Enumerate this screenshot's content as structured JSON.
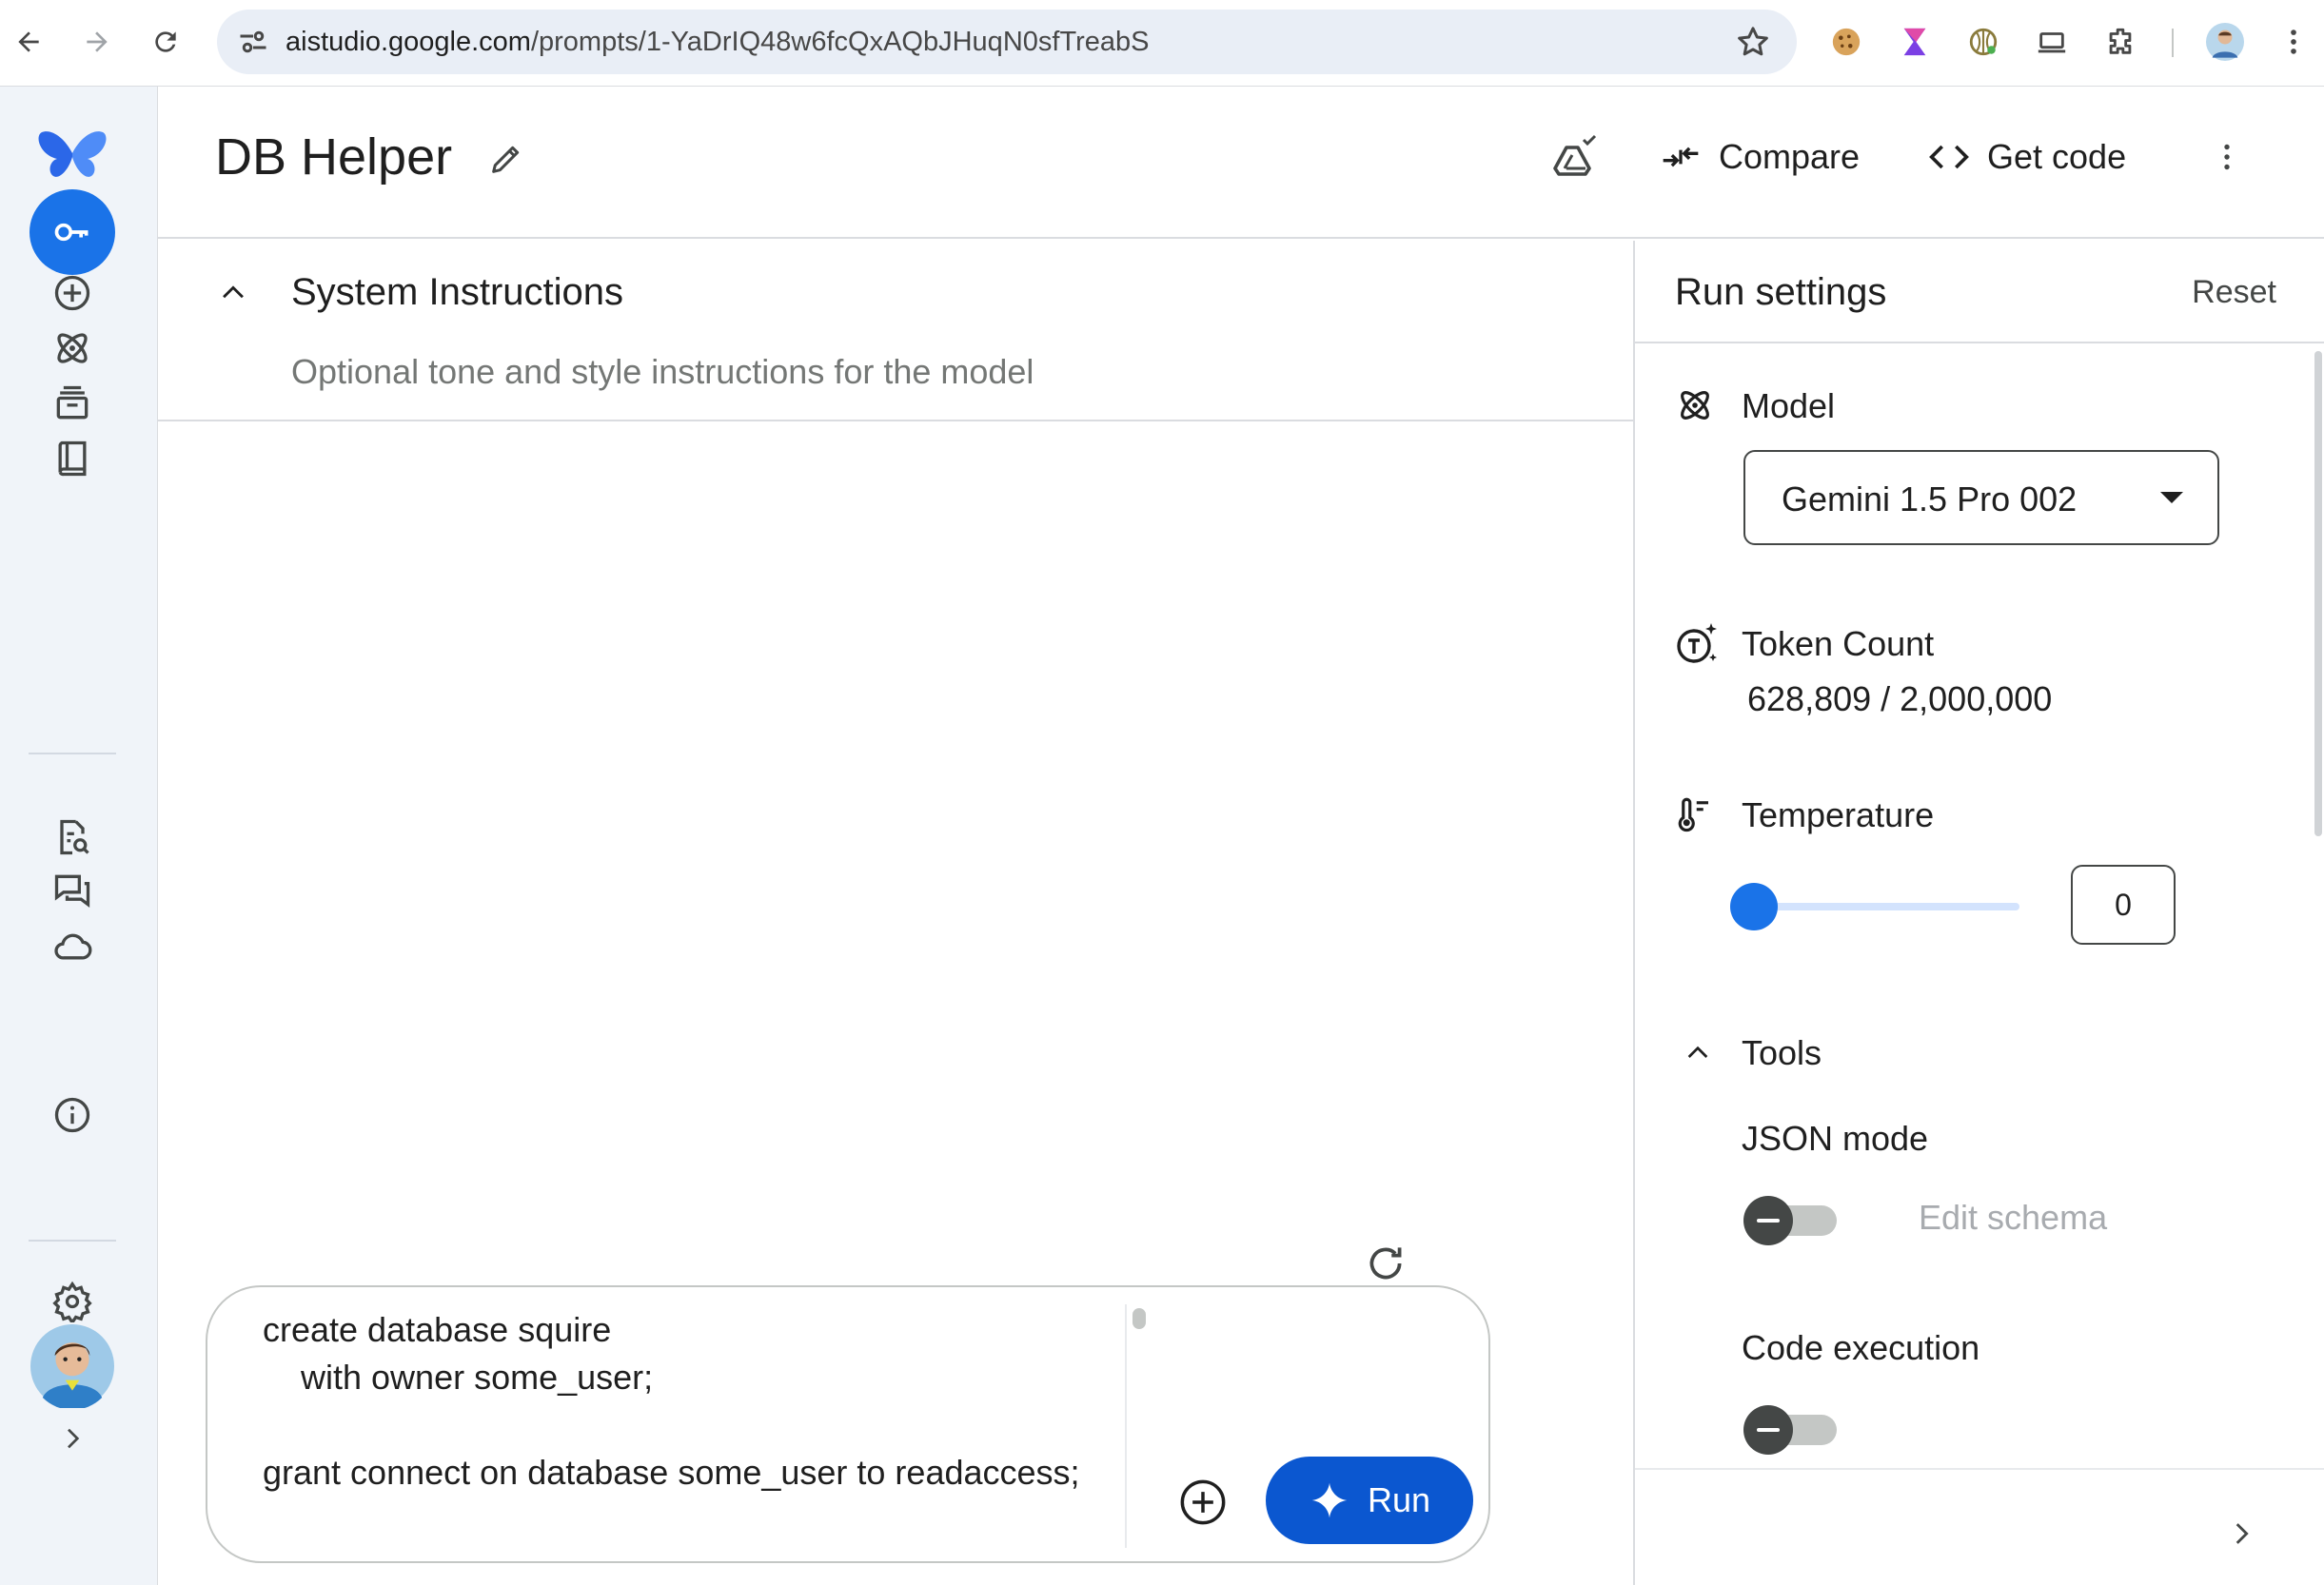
{
  "browser": {
    "url_host": "aistudio.google.com",
    "url_path": "/prompts/1-YaDrIQ48w6fcQxAQbJHuqN0sfTreabS"
  },
  "header": {
    "title": "DB Helper",
    "compare_label": "Compare",
    "get_code_label": "Get code"
  },
  "system_instructions": {
    "title": "System Instructions",
    "placeholder": "Optional tone and style instructions for the model"
  },
  "prompt": {
    "text": "create database squire\n    with owner some_user;\n\ngrant connect on database some_user to readaccess;",
    "run_label": "Run"
  },
  "run_settings": {
    "title": "Run settings",
    "reset_label": "Reset",
    "model": {
      "label": "Model",
      "value": "Gemini 1.5 Pro 002"
    },
    "token_count": {
      "label": "Token Count",
      "value": "628,809 / 2,000,000",
      "used": 628809,
      "max": 2000000
    },
    "temperature": {
      "label": "Temperature",
      "value": "0",
      "slider_fraction": 0
    },
    "tools": {
      "label": "Tools",
      "json_mode": {
        "label": "JSON mode",
        "enabled": false,
        "edit_schema_label": "Edit schema"
      },
      "code_execution": {
        "label": "Code execution",
        "enabled": false
      }
    }
  },
  "colors": {
    "accent": "#0b57d0",
    "nav_active": "#1a73e8",
    "nav_bg": "#f0f4f9",
    "omnibox_bg": "#e9eef6"
  }
}
